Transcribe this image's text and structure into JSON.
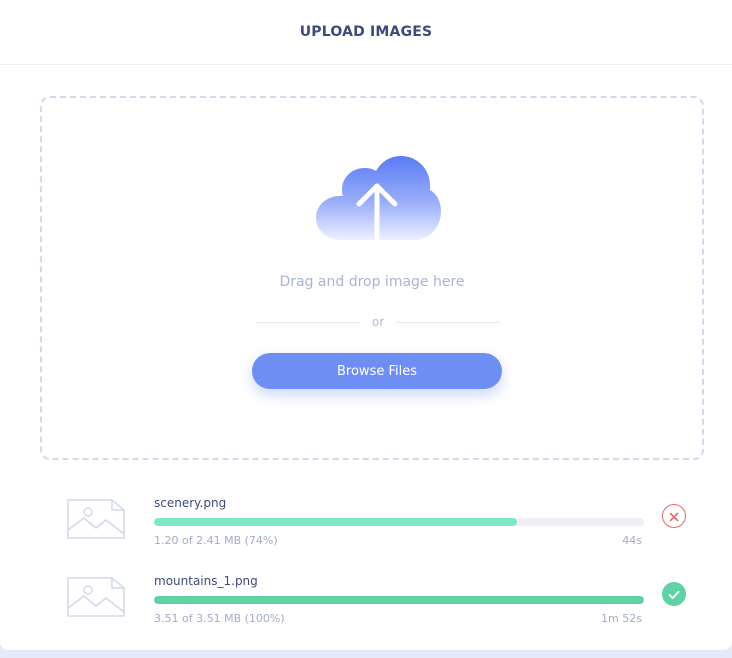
{
  "header": {
    "title": "UPLOAD IMAGES"
  },
  "dropzone": {
    "drag_text": "Drag and drop image here",
    "or_text": "or",
    "browse_label": "Browse Files",
    "icon": "cloud-upload-icon"
  },
  "files": [
    {
      "name": "scenery.png",
      "size_text": "1.20 of 2.41 MB (74%)",
      "time_text": "44s",
      "progress": 0.74,
      "status": "uploading",
      "status_icon": "close-circle-icon",
      "bar_color": "#7ee8c4"
    },
    {
      "name": "mountains_1.png",
      "size_text": "3.51 of 3.51 MB (100%)",
      "time_text": "1m 52s",
      "progress": 1.0,
      "status": "complete",
      "status_icon": "check-circle-icon",
      "bar_color": "#5fd3a6"
    }
  ],
  "colors": {
    "accent": "#6f8ef3",
    "title": "#3d4a7a",
    "muted": "#a3acc9",
    "success": "#5fd3a6",
    "error": "#e56b6b"
  }
}
